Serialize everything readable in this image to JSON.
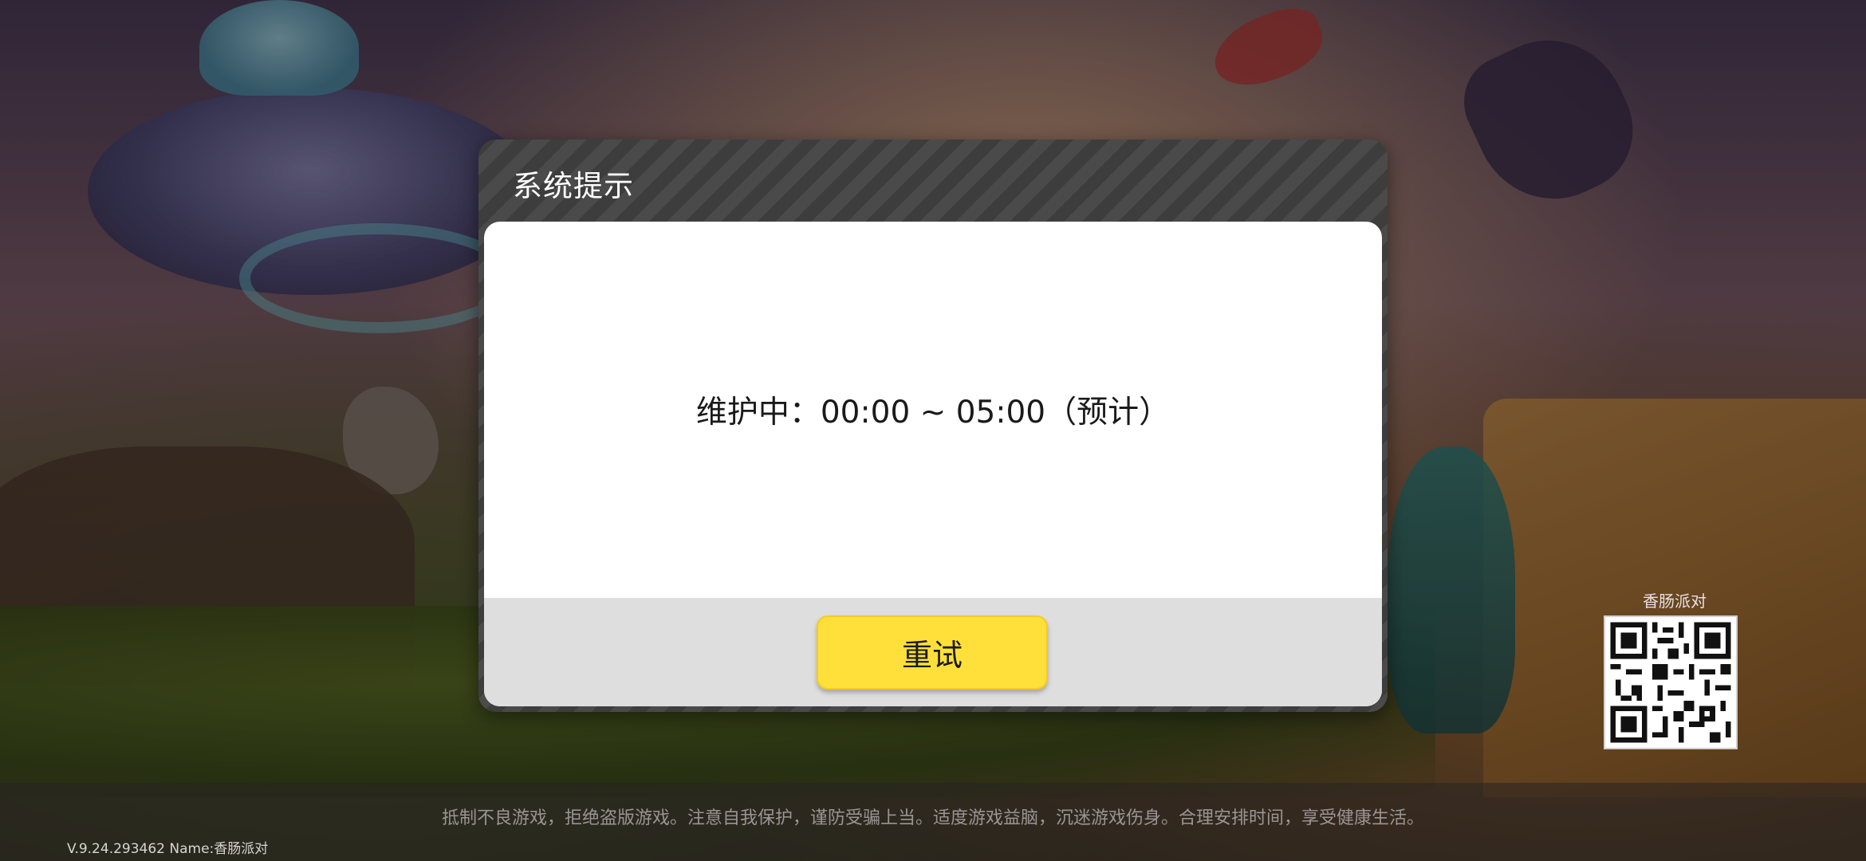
{
  "dialog": {
    "title": "系统提示",
    "message": "维护中：00:00 ~ 05:00（预计）",
    "retry_label": "重试",
    "retry_color": "#ffe03a"
  },
  "qr": {
    "label": "香肠派对",
    "icon": "qr-code-icon"
  },
  "footer": {
    "notice": "抵制不良游戏，拒绝盗版游戏。注意自我保护，谨防受骗上当。适度游戏益脑，沉迷游戏伤身。合理安排时间，享受健康生活。",
    "version": "V.9.24.293462 Name:香肠派对"
  }
}
